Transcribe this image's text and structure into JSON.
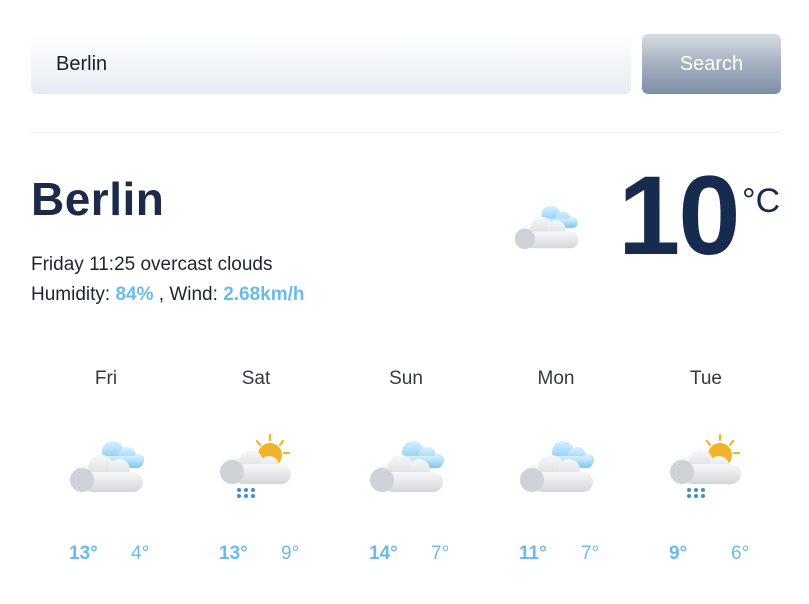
{
  "search": {
    "value": "Berlin",
    "button_label": "Search"
  },
  "current": {
    "city": "Berlin",
    "day_time": "Friday 11:25",
    "condition": "overcast clouds",
    "humidity_label": "Humidity:",
    "humidity_value": "84%",
    "wind_label": ", Wind:",
    "wind_value": "2.68km/h",
    "temperature": "10",
    "unit": "°C",
    "icon": "overcast-clouds-icon"
  },
  "forecast": [
    {
      "day": "Fri",
      "high": "13°",
      "low": "4°",
      "icon": "clouds-icon"
    },
    {
      "day": "Sat",
      "high": "13°",
      "low": "9°",
      "icon": "sun-cloud-rain-icon"
    },
    {
      "day": "Sun",
      "high": "14°",
      "low": "7°",
      "icon": "clouds-icon"
    },
    {
      "day": "Mon",
      "high": "11°",
      "low": "7°",
      "icon": "clouds-icon"
    },
    {
      "day": "Tue",
      "high": "9°",
      "low": "6°",
      "icon": "sun-cloud-rain-icon"
    }
  ],
  "colors": {
    "accent": "#6bbbea",
    "heading": "#1c2b4a",
    "temperature": "#162b4d",
    "sun": "#f0b429",
    "rain": "#3a8fd6"
  }
}
